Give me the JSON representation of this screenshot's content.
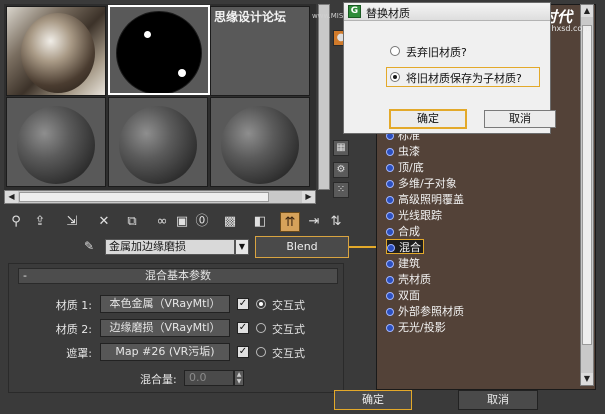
{
  "watermark": {
    "forum_cn": "思缘设计论坛",
    "forum_url": "www.MISSVUAN.COM",
    "logo": "火星时代",
    "site": "www.hxsd.com"
  },
  "toolbar": {
    "icons": [
      "get-material-icon",
      "put-to-scene-icon",
      "assign-icon",
      "reset-icon",
      "make-copy-icon",
      "unique-icon",
      "put-library-icon",
      "material-id-icon",
      "show-map-icon",
      "show-end-result-icon",
      "go-parent-icon",
      "go-sibling-icon"
    ]
  },
  "material": {
    "name": "金属加边缘磨损",
    "type_button": "Blend"
  },
  "rollout": {
    "title": "混合基本参数",
    "collapse": "-",
    "rows": [
      {
        "label": "材质 1:",
        "map": "本色金属（VRayMtl）",
        "checked": true,
        "radio_label": "交互式",
        "radio_on": true
      },
      {
        "label": "材质 2:",
        "map": "边缘磨损（VRayMtl）",
        "checked": true,
        "radio_label": "交互式",
        "radio_on": false
      },
      {
        "label": "遮罩:",
        "map": "Map #26 (VR污垢)",
        "checked": true,
        "radio_label": "交互式",
        "radio_on": false
      }
    ],
    "mix_label": "混合量:",
    "mix_value": "0.0"
  },
  "browser": {
    "items": [
      "标准",
      "虫漆",
      "顶/底",
      "多维/子对象",
      "高级照明覆盖",
      "光线跟踪",
      "合成",
      "混合",
      "建筑",
      "壳材质",
      "双面",
      "外部参照材质",
      "无光/投影"
    ],
    "selected_index": 7,
    "ok": "确定",
    "cancel": "取消"
  },
  "dialog": {
    "title": "替换材质",
    "option1": "丢弃旧材质?",
    "option2": "将旧材质保存为子材质?",
    "selected": 2,
    "ok": "确定",
    "cancel": "取消"
  }
}
